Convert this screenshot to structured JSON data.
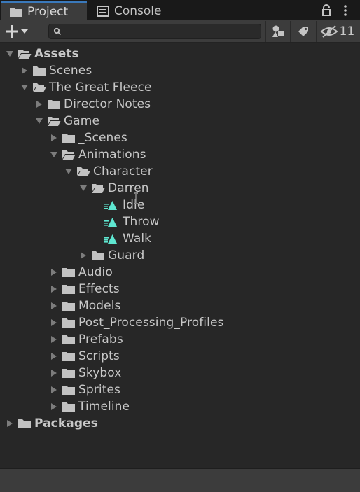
{
  "tabs": [
    {
      "label": "Project",
      "icon": "folder-icon",
      "active": true
    },
    {
      "label": "Console",
      "icon": "console-icon",
      "active": false
    }
  ],
  "toolbar": {
    "add_icon": "plus-icon",
    "search_value": "",
    "search_icon": "search-icon",
    "hidden_count": "11"
  },
  "tree": [
    {
      "label": "Assets",
      "depth": 0,
      "expanded": true,
      "type": "folder",
      "bold": true
    },
    {
      "label": "Scenes",
      "depth": 1,
      "expanded": false,
      "type": "folder"
    },
    {
      "label": "The Great Fleece",
      "depth": 1,
      "expanded": true,
      "type": "folder"
    },
    {
      "label": "Director Notes",
      "depth": 2,
      "expanded": false,
      "type": "folder"
    },
    {
      "label": "Game",
      "depth": 2,
      "expanded": true,
      "type": "folder"
    },
    {
      "label": "_Scenes",
      "depth": 3,
      "expanded": false,
      "type": "folder"
    },
    {
      "label": "Animations",
      "depth": 3,
      "expanded": true,
      "type": "folder"
    },
    {
      "label": "Character",
      "depth": 4,
      "expanded": true,
      "type": "folder"
    },
    {
      "label": "Darren",
      "depth": 5,
      "expanded": true,
      "type": "folder"
    },
    {
      "label": "Idle",
      "depth": 6,
      "type": "animation"
    },
    {
      "label": "Throw",
      "depth": 6,
      "type": "animation"
    },
    {
      "label": "Walk",
      "depth": 6,
      "type": "animation"
    },
    {
      "label": "Guard",
      "depth": 5,
      "expanded": false,
      "type": "folder"
    },
    {
      "label": "Audio",
      "depth": 3,
      "expanded": false,
      "type": "folder"
    },
    {
      "label": "Effects",
      "depth": 3,
      "expanded": false,
      "type": "folder"
    },
    {
      "label": "Models",
      "depth": 3,
      "expanded": false,
      "type": "folder"
    },
    {
      "label": "Post_Processing_Profiles",
      "depth": 3,
      "expanded": false,
      "type": "folder"
    },
    {
      "label": "Prefabs",
      "depth": 3,
      "expanded": false,
      "type": "folder"
    },
    {
      "label": "Scripts",
      "depth": 3,
      "expanded": false,
      "type": "folder"
    },
    {
      "label": "Skybox",
      "depth": 3,
      "expanded": false,
      "type": "folder"
    },
    {
      "label": "Sprites",
      "depth": 3,
      "expanded": false,
      "type": "folder"
    },
    {
      "label": "Timeline",
      "depth": 3,
      "expanded": false,
      "type": "folder"
    },
    {
      "label": "Packages",
      "depth": 0,
      "expanded": false,
      "type": "folder",
      "bold": true
    }
  ],
  "colors": {
    "animation_icon": "#5ee6d0",
    "tab_accent": "#3a79bb",
    "tree_background": "#272727"
  }
}
